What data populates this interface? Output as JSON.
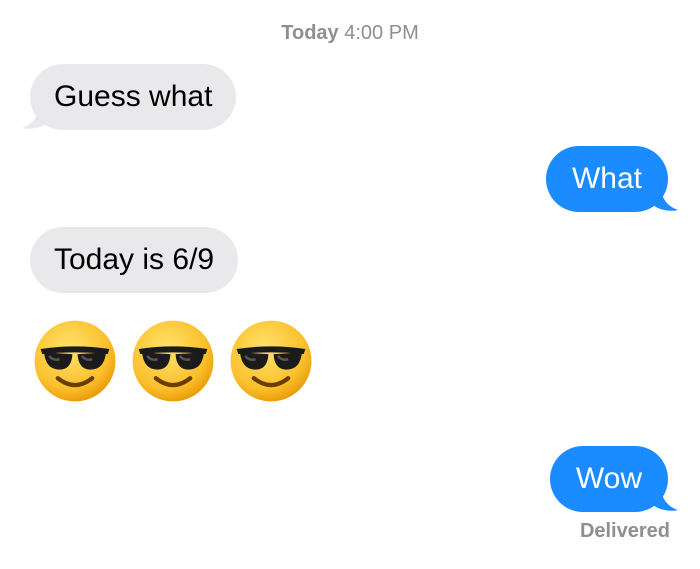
{
  "conversation": {
    "timestamp_day": "Today",
    "timestamp_time": "4:00 PM",
    "messages": [
      {
        "direction": "incoming",
        "text": "Guess what"
      },
      {
        "direction": "outgoing",
        "text": "What"
      },
      {
        "direction": "incoming",
        "text": "Today is 6/9"
      },
      {
        "direction": "outgoing",
        "text": "Wow"
      }
    ],
    "emoji_message": {
      "icon": "smiling-face-with-sunglasses-icon",
      "count": 3
    },
    "delivery_status": "Delivered"
  },
  "colors": {
    "incoming_bubble": "#e9e9eb",
    "outgoing_bubble": "#1a8cff",
    "meta_text": "#8e8e93"
  }
}
